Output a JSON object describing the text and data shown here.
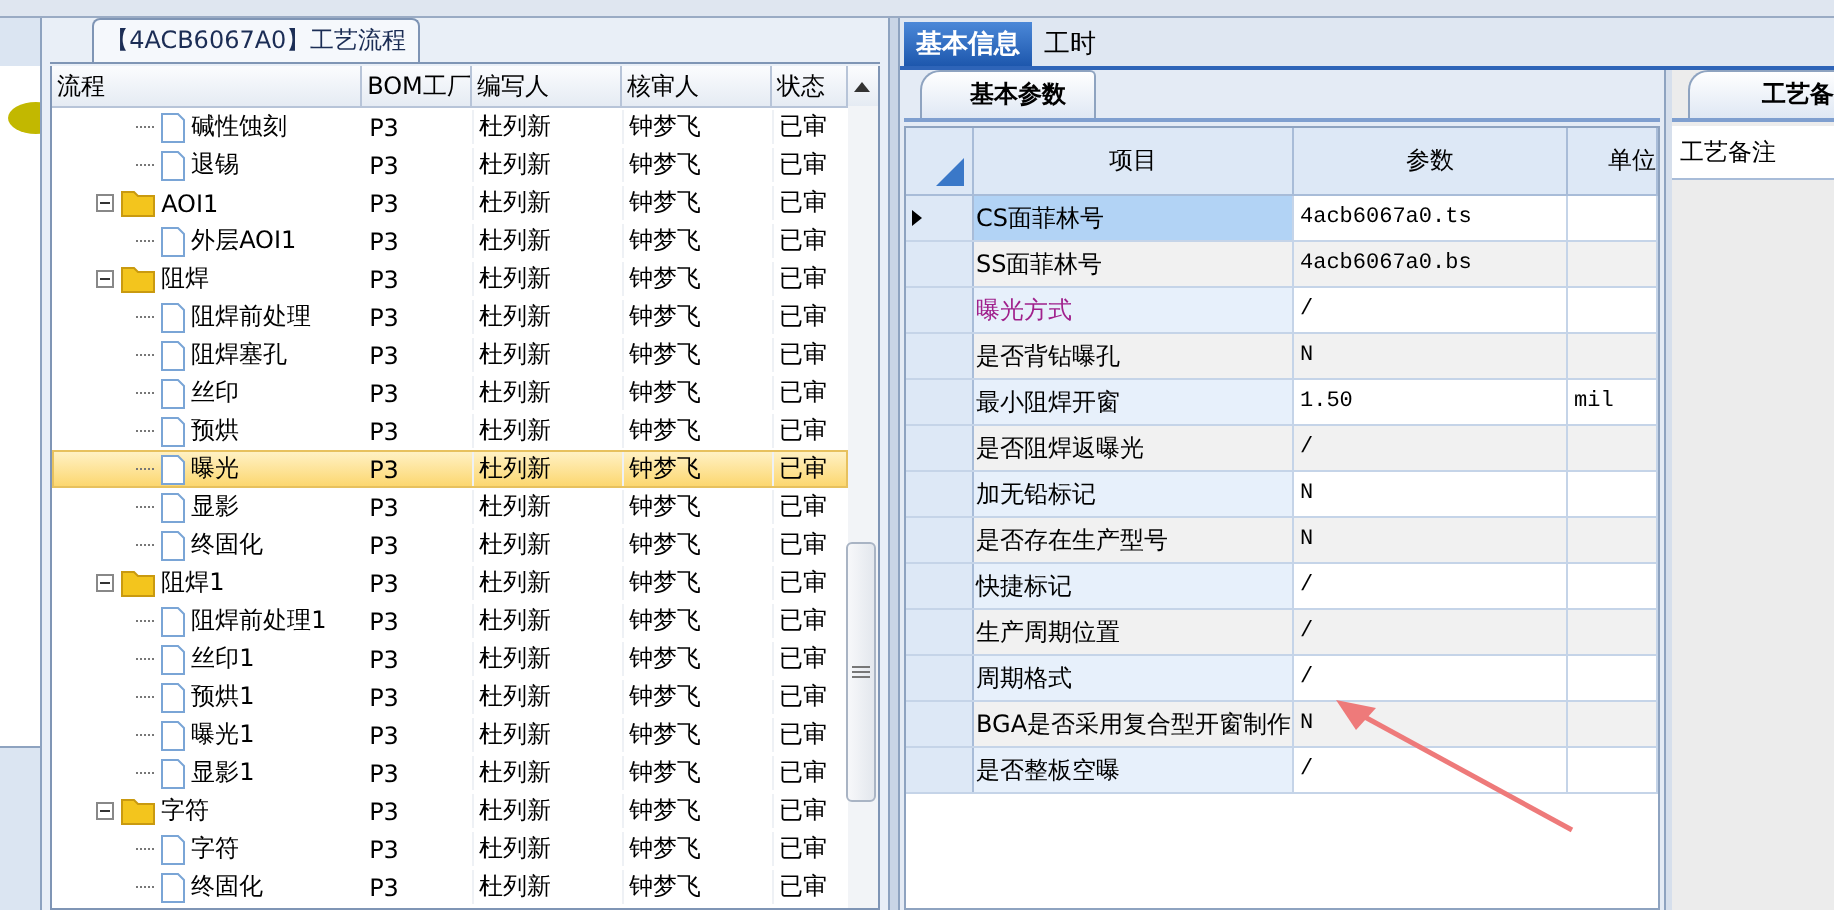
{
  "flow_panel": {
    "title": "【4ACB6067A0】工艺流程",
    "columns": [
      "流程",
      "BOM工厂",
      "编写人",
      "核审人",
      "状态"
    ],
    "nodes": [
      {
        "kind": "leaf",
        "name": "碱性蚀刻",
        "bom": "P3",
        "author": "杜列新",
        "reviewer": "钟梦飞",
        "status": "已审",
        "selected": false
      },
      {
        "kind": "leaf",
        "name": "退锡",
        "bom": "P3",
        "author": "杜列新",
        "reviewer": "钟梦飞",
        "status": "已审",
        "selected": false
      },
      {
        "kind": "group",
        "name": "AOI1",
        "bom": "P3",
        "author": "杜列新",
        "reviewer": "钟梦飞",
        "status": "已审",
        "selected": false,
        "expanded": true,
        "children": [
          {
            "kind": "leaf",
            "name": "外层AOI1",
            "bom": "P3",
            "author": "杜列新",
            "reviewer": "钟梦飞",
            "status": "已审",
            "selected": false
          }
        ]
      },
      {
        "kind": "group",
        "name": "阻焊",
        "bom": "P3",
        "author": "杜列新",
        "reviewer": "钟梦飞",
        "status": "已审",
        "selected": false,
        "expanded": true,
        "children": [
          {
            "kind": "leaf",
            "name": "阻焊前处理",
            "bom": "P3",
            "author": "杜列新",
            "reviewer": "钟梦飞",
            "status": "已审",
            "selected": false
          },
          {
            "kind": "leaf",
            "name": "阻焊塞孔",
            "bom": "P3",
            "author": "杜列新",
            "reviewer": "钟梦飞",
            "status": "已审",
            "selected": false
          },
          {
            "kind": "leaf",
            "name": "丝印",
            "bom": "P3",
            "author": "杜列新",
            "reviewer": "钟梦飞",
            "status": "已审",
            "selected": false
          },
          {
            "kind": "leaf",
            "name": "预烘",
            "bom": "P3",
            "author": "杜列新",
            "reviewer": "钟梦飞",
            "status": "已审",
            "selected": false
          },
          {
            "kind": "leaf",
            "name": "曝光",
            "bom": "P3",
            "author": "杜列新",
            "reviewer": "钟梦飞",
            "status": "已审",
            "selected": true
          },
          {
            "kind": "leaf",
            "name": "显影",
            "bom": "P3",
            "author": "杜列新",
            "reviewer": "钟梦飞",
            "status": "已审",
            "selected": false
          },
          {
            "kind": "leaf",
            "name": "终固化",
            "bom": "P3",
            "author": "杜列新",
            "reviewer": "钟梦飞",
            "status": "已审",
            "selected": false
          }
        ]
      },
      {
        "kind": "group",
        "name": "阻焊1",
        "bom": "P3",
        "author": "杜列新",
        "reviewer": "钟梦飞",
        "status": "已审",
        "selected": false,
        "expanded": true,
        "children": [
          {
            "kind": "leaf",
            "name": "阻焊前处理1",
            "bom": "P3",
            "author": "杜列新",
            "reviewer": "钟梦飞",
            "status": "已审",
            "selected": false
          },
          {
            "kind": "leaf",
            "name": "丝印1",
            "bom": "P3",
            "author": "杜列新",
            "reviewer": "钟梦飞",
            "status": "已审",
            "selected": false
          },
          {
            "kind": "leaf",
            "name": "预烘1",
            "bom": "P3",
            "author": "杜列新",
            "reviewer": "钟梦飞",
            "status": "已审",
            "selected": false
          },
          {
            "kind": "leaf",
            "name": "曝光1",
            "bom": "P3",
            "author": "杜列新",
            "reviewer": "钟梦飞",
            "status": "已审",
            "selected": false
          },
          {
            "kind": "leaf",
            "name": "显影1",
            "bom": "P3",
            "author": "杜列新",
            "reviewer": "钟梦飞",
            "status": "已审",
            "selected": false
          }
        ]
      },
      {
        "kind": "group",
        "name": "字符",
        "bom": "P3",
        "author": "杜列新",
        "reviewer": "钟梦飞",
        "status": "已审",
        "selected": false,
        "expanded": true,
        "children": [
          {
            "kind": "leaf",
            "name": "字符",
            "bom": "P3",
            "author": "杜列新",
            "reviewer": "钟梦飞",
            "status": "已审",
            "selected": false
          },
          {
            "kind": "leaf",
            "name": "终固化",
            "bom": "P3",
            "author": "杜列新",
            "reviewer": "钟梦飞",
            "status": "已审",
            "selected": false
          }
        ]
      }
    ]
  },
  "tabs": [
    {
      "label": "基本信息",
      "selected": true
    },
    {
      "label": "工时",
      "selected": false
    }
  ],
  "params_panel": {
    "tab": "基本参数",
    "columns": [
      "项目",
      "参数",
      "单位"
    ],
    "rows": [
      {
        "item": "CS面菲林号",
        "value": "4acb6067a0.ts",
        "selected": true
      },
      {
        "item": "SS面菲林号",
        "value": "4acb6067a0.bs",
        "selected": false
      },
      {
        "item": "曝光方式",
        "value": "/",
        "selected": false,
        "color": "#a0208c"
      },
      {
        "item": "是否背钻曝孔",
        "value": "N",
        "selected": false
      },
      {
        "item": "最小阻焊开窗",
        "value": "1.50",
        "unit": "mil",
        "selected": false
      },
      {
        "item": "是否阻焊返曝光",
        "value": "/",
        "selected": false
      },
      {
        "item": "加无铅标记",
        "value": "N",
        "selected": false
      },
      {
        "item": "是否存在生产型号",
        "value": "N",
        "selected": false
      },
      {
        "item": "快捷标记",
        "value": "/",
        "selected": false
      },
      {
        "item": "生产周期位置",
        "value": "/",
        "selected": false
      },
      {
        "item": "周期格式",
        "value": "/",
        "selected": false
      },
      {
        "item": "BGA是否采用复合型开窗制作",
        "value": "N",
        "selected": false
      },
      {
        "item": "是否整板空曝",
        "value": "/",
        "selected": false
      }
    ]
  },
  "notes_panel": {
    "tab": "工艺备",
    "header": "工艺备注"
  }
}
